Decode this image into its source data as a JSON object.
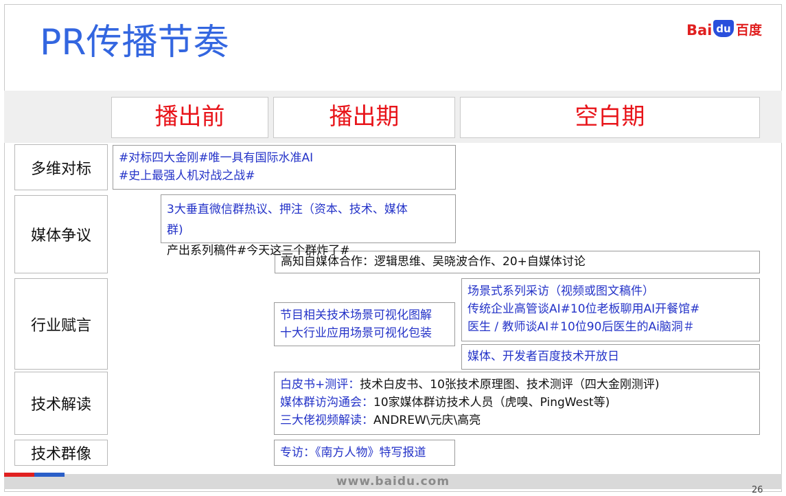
{
  "slide": {
    "title": "PR传播节奏",
    "logo": {
      "bai": "Bai",
      "du": "du",
      "baidu": "百度"
    },
    "columns": [
      "播出前",
      "播出期",
      "空白期"
    ],
    "rows": [
      "多维对标",
      "媒体争议",
      "行业赋言",
      "技术解读",
      "技术群像"
    ],
    "cells": {
      "dimension_compare": [
        "#对标四大金刚#唯一具有国际水准AI",
        "#史上最强人机对战之战#"
      ],
      "media_debate": [
        "3大垂直微信群热议、押注（资本、技术、媒体",
        "群)"
      ],
      "media_debate_overflow": "产出系列稿件#今天这三个群炸了#",
      "media_cooperation": "高知自媒体合作：逻辑思维、吴晓波合作、20+自媒体讨论",
      "industry_visual": [
        "节目相关技术场景可视化图解",
        "十大行业应用场景可视化包装"
      ],
      "industry_interview": [
        "场景式系列采访（视频或图文稿件）",
        "传统企业高管谈AI#10位老板聊用AI开餐馆#",
        "医生 / 教师谈AI＃10位90后医生的Ai脑洞＃"
      ],
      "open_day": "媒体、开发者百度技术开放日",
      "tech_reading": [
        {
          "label": "白皮书+测评：",
          "text": "技术白皮书、10张技术原理图、技术测评（四大金刚测评)"
        },
        {
          "label": "媒体群访沟通会：",
          "text": "10家媒体群访技术人员（虎嗅、PingWest等)"
        },
        {
          "label": "三大佬视频解读：",
          "text": "ANDREW\\元庆\\高亮"
        }
      ],
      "tech_portrait": "专访：《南方人物》特写报道"
    },
    "footer": "www.baidu.com",
    "page_number": "26"
  },
  "colors": {
    "title": "#3366e0",
    "column_header": "#e8141a",
    "cell_blue": "#2433c8",
    "logo_red": "#e02020",
    "logo_blue": "#2a4fdc"
  }
}
